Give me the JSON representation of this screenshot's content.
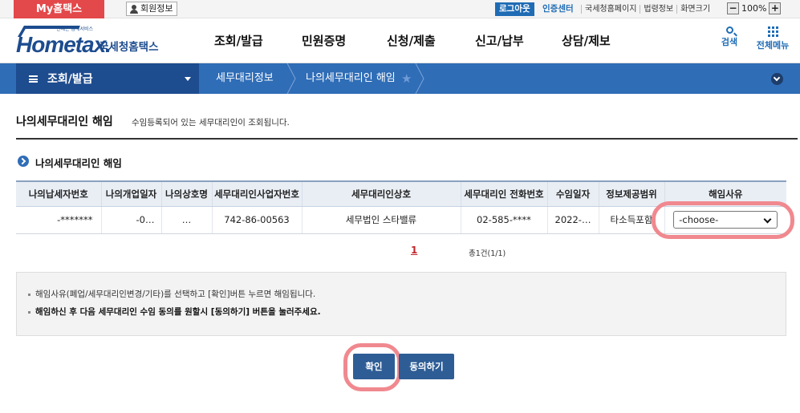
{
  "topbar": {
    "my_hometax": "My홈택스",
    "member_info": "회원정보",
    "logout": "로그아웃",
    "cert_center": "인증센터",
    "links": [
      "국세청홈페이지",
      "법령정보",
      "화면크기"
    ],
    "zoom": "100%"
  },
  "header": {
    "logo_sub": "언제든 납세서비스",
    "logo_main": "Hometax.",
    "logo_kr": "국세청홈택스",
    "nav": [
      "조회/발급",
      "민원증명",
      "신청/제출",
      "신고/납부",
      "상담/제보"
    ],
    "search": "검색",
    "all_menu": "전체메뉴"
  },
  "breadcrumb": {
    "menu": "조회/발급",
    "level1": "세무대리정보",
    "level2": "나의세무대리인 해임"
  },
  "page": {
    "title": "나의세무대리인 해임",
    "description": "수임등록되어 있는 세무대리인이 조회됩니다.",
    "section_title": "나의세무대리인 해임"
  },
  "table": {
    "headers": [
      "나의납세자번호",
      "나의개업일자",
      "나의상호명",
      "세무대리인사업자번호",
      "세무대리인상호",
      "세무대리인 전화번호",
      "수임일자",
      "정보제공범위",
      "해임사유"
    ],
    "rows": [
      [
        "-*******",
        "-0…",
        "…",
        "742-86-00563",
        "세무법인 스타밸류",
        "02-585-****",
        "2022-…",
        "타소득포함",
        "-choose-"
      ]
    ]
  },
  "pagination": {
    "current": "1",
    "total": "총1건(1/1)"
  },
  "notice": [
    "해임사유(폐업/세무대리인변경/기타)를 선택하고 [확인]버튼 누르면 해임됩니다.",
    "해임하신 후 다음 세무대리인 수임 동의를 원할시 [동의하기] 버튼을 눌러주세요."
  ],
  "buttons": {
    "confirm": "확인",
    "agree": "동의하기"
  },
  "colors": {
    "brand": "#1d4c8f",
    "breadcrumb_bg": "#2f6db7",
    "myhome_red": "#e3484a",
    "highlight": "#f0898f"
  }
}
